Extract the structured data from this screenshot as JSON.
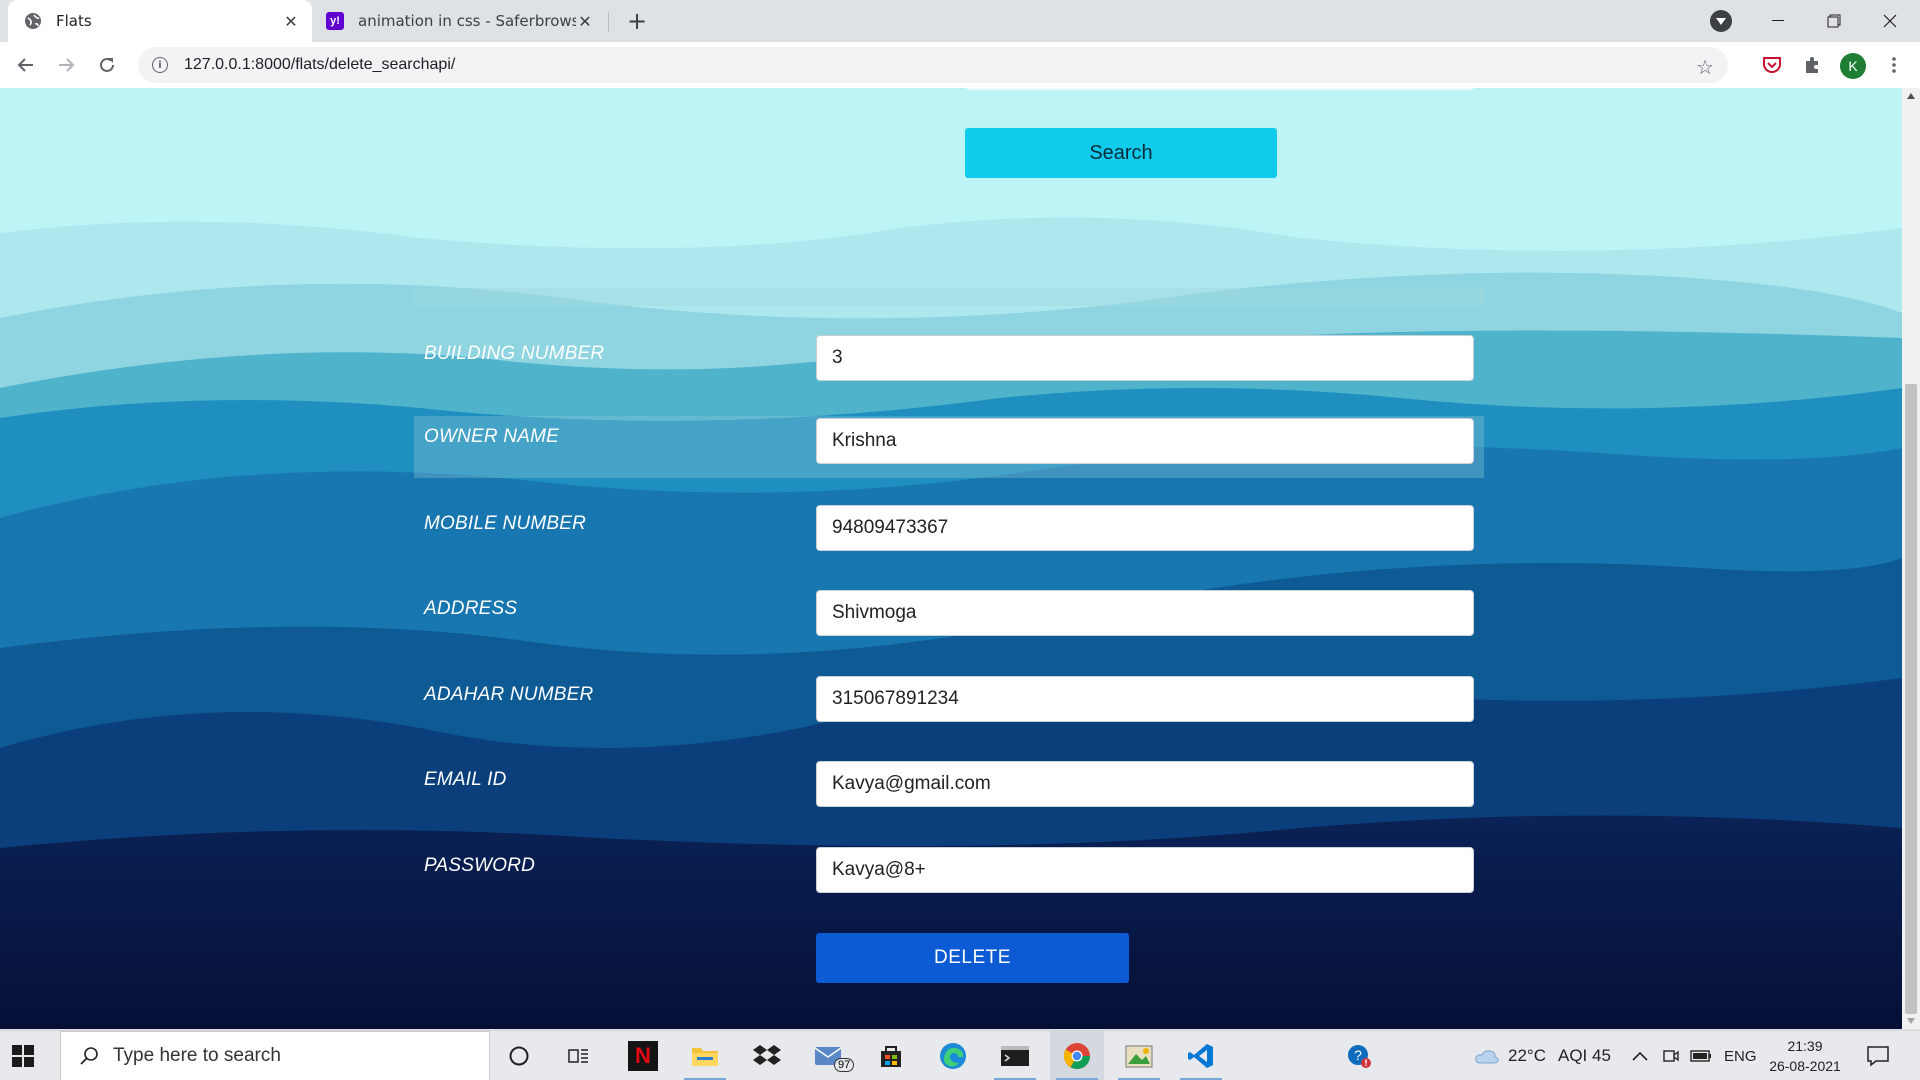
{
  "browser": {
    "tabs": [
      {
        "title": "Flats",
        "active": true,
        "favicon": "globe-icon"
      },
      {
        "title": "animation in css - Saferbrowser Y",
        "active": false,
        "favicon": "yahoo-icon",
        "favicon_text": "y!"
      }
    ],
    "url": "127.0.0.1:8000/flats/delete_searchapi/",
    "profile_initial": "K"
  },
  "page": {
    "search_button": "Search",
    "fields": [
      {
        "label": "BUILDING NUMBER",
        "value": "3"
      },
      {
        "label": "OWNER NAME",
        "value": "Krishna"
      },
      {
        "label": "MOBILE NUMBER",
        "value": "94809473367"
      },
      {
        "label": "ADDRESS",
        "value": "Shivmoga"
      },
      {
        "label": "ADAHAR NUMBER",
        "value": "315067891234"
      },
      {
        "label": "EMAIL ID",
        "value": "Kavya@gmail.com"
      },
      {
        "label": "PASSWORD",
        "value": "Kavya@8+"
      }
    ],
    "delete_button": "DELETE",
    "colors": {
      "search_button": "#10cbec",
      "delete_button": "#0d5bd4",
      "sky": "#bdf4f6",
      "deep_water": "#0a1c47"
    }
  },
  "taskbar": {
    "search_placeholder": "Type here to search",
    "mail_badge": "97",
    "netflix_letter": "N",
    "weather": "22°C",
    "aqi": "AQI 45",
    "language": "ENG",
    "time": "21:39",
    "date": "26-08-2021"
  }
}
